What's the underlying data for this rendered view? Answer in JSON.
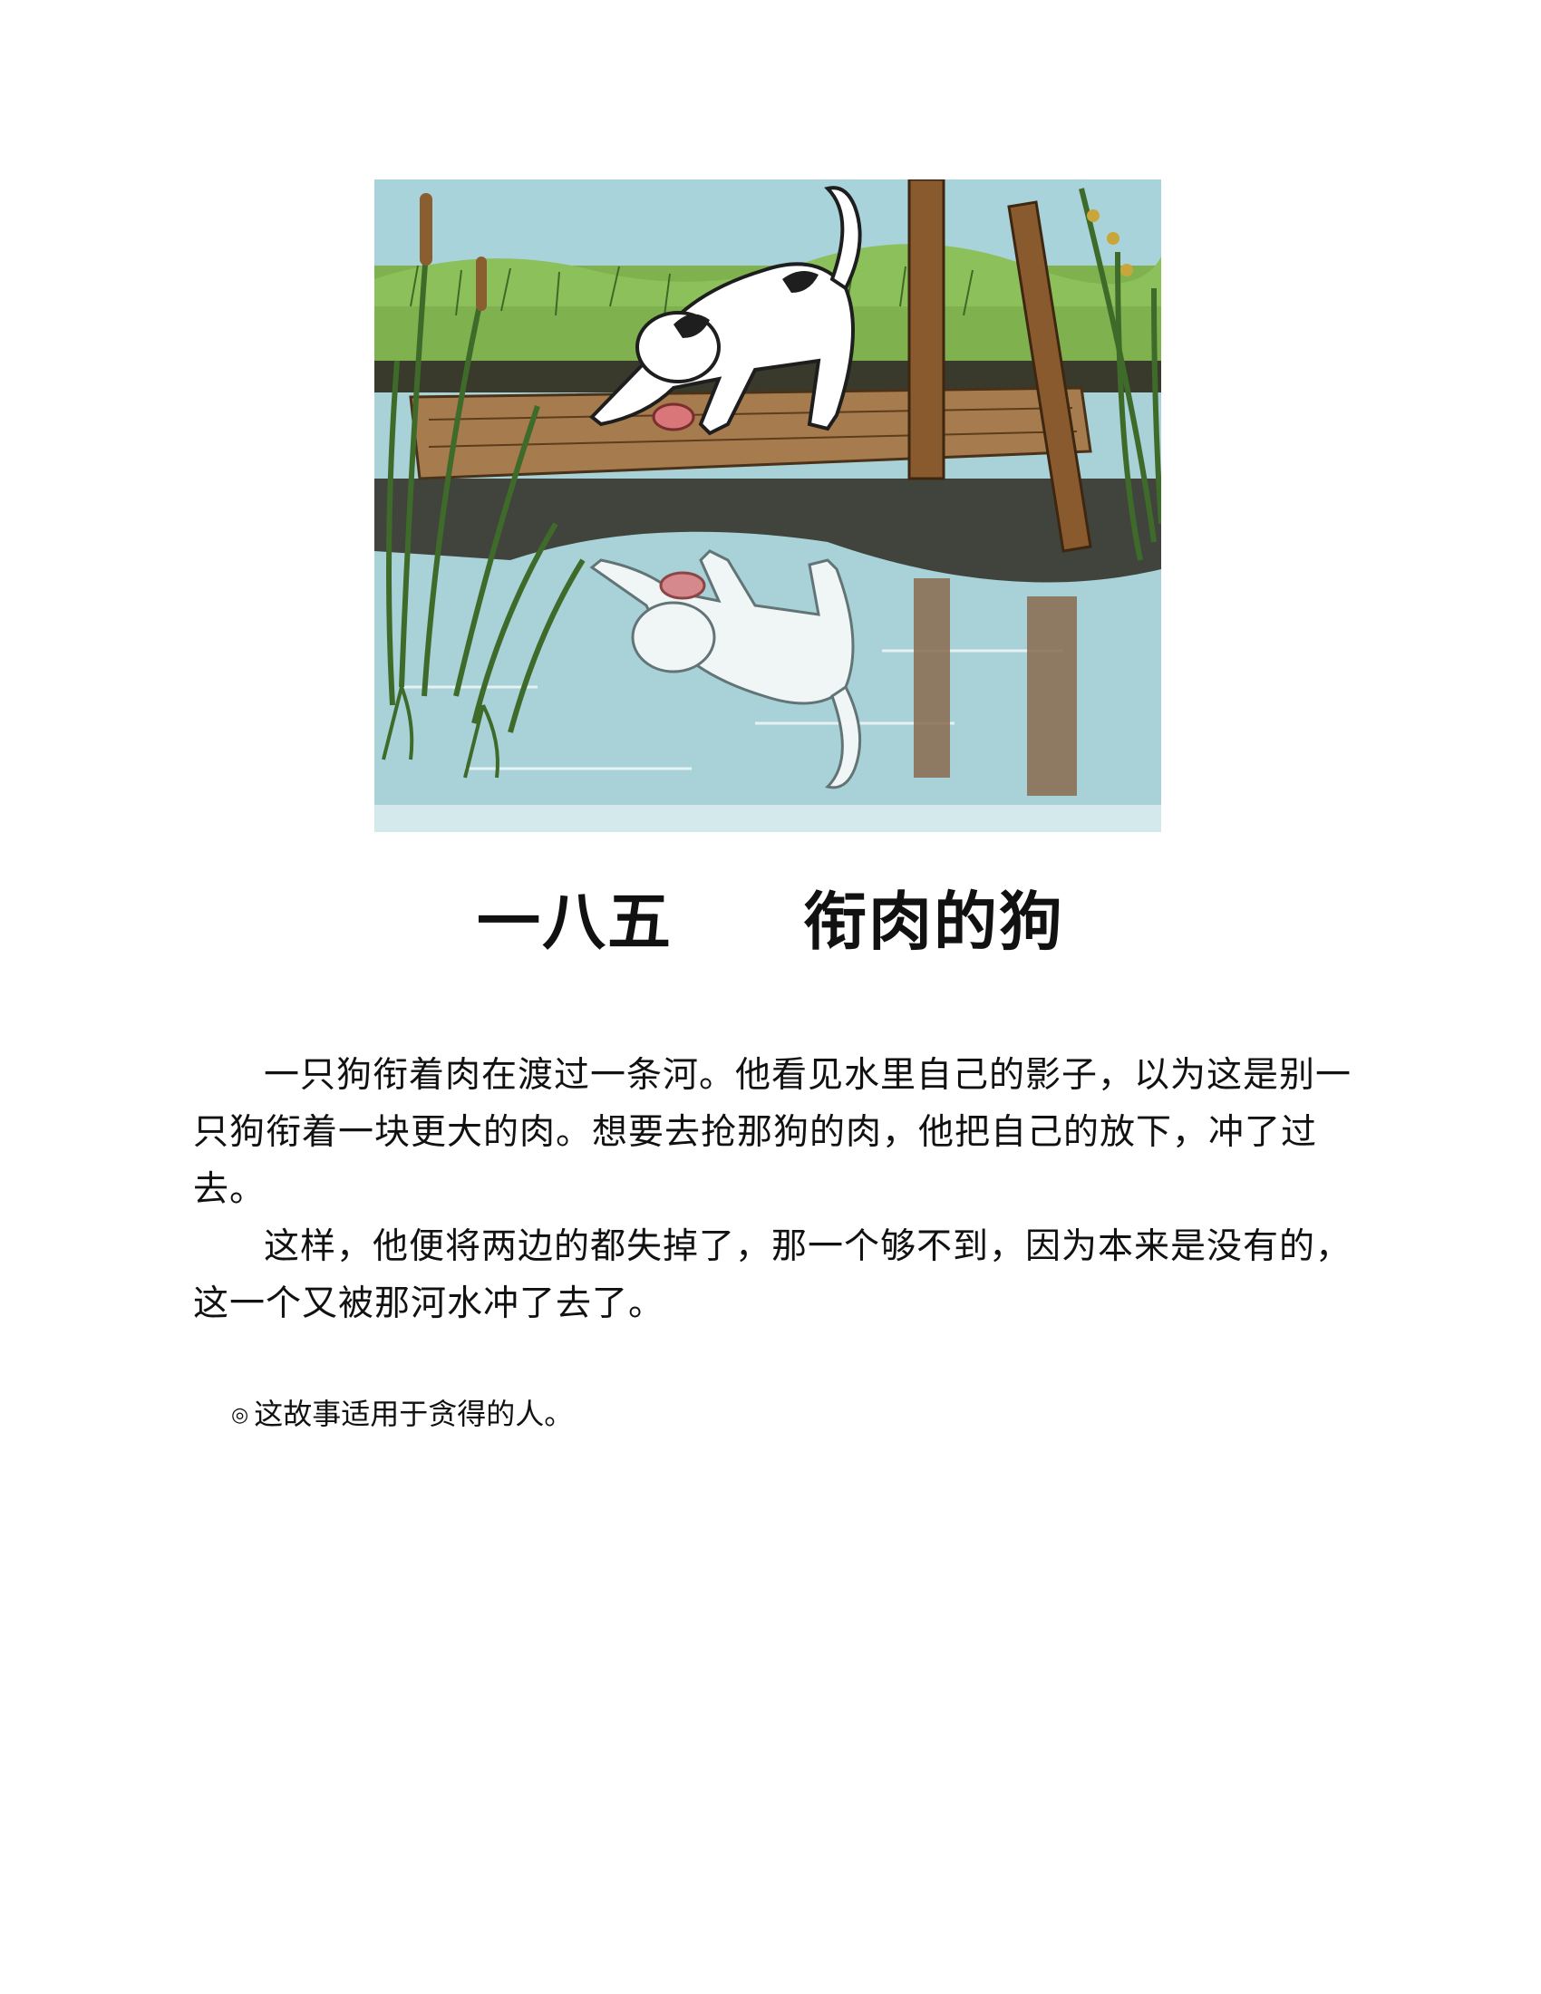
{
  "illustration": {
    "icon": "dog-on-bridge-with-reflection-illustration"
  },
  "title": "一八五　　衔肉的狗",
  "paragraphs": [
    "一只狗衔着肉在渡过一条河。他看见水里自己的影子，以为这是别一只狗衔着一块更大的肉。想要去抢那狗的肉，他把自己的放下，冲了过去。",
    "这样，他便将两边的都失掉了，那一个够不到，因为本来是没有的，这一个又被那河水冲了去了。"
  ],
  "note": {
    "bullet": "◎",
    "text": "这故事适用于贪得的人。"
  }
}
